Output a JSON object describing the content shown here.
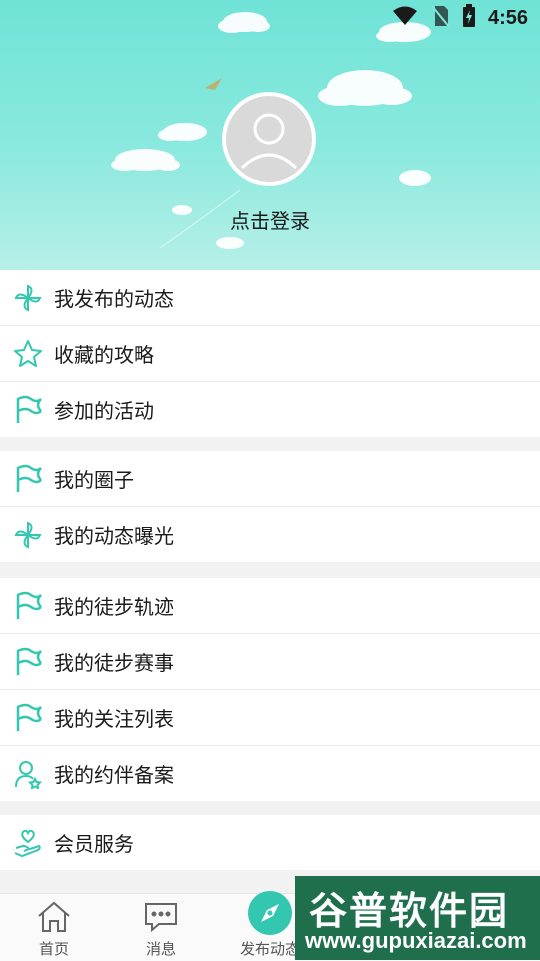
{
  "status": {
    "time": "4:56"
  },
  "profile": {
    "login_text": "点击登录"
  },
  "menu": {
    "group1": [
      {
        "label": "我发布的动态",
        "icon": "pinwheel-icon"
      },
      {
        "label": "收藏的攻略",
        "icon": "star-icon"
      },
      {
        "label": "参加的活动",
        "icon": "flag-icon"
      }
    ],
    "group2": [
      {
        "label": "我的圈子",
        "icon": "flag-icon"
      },
      {
        "label": "我的动态曝光",
        "icon": "pinwheel-icon"
      }
    ],
    "group3": [
      {
        "label": "我的徒步轨迹",
        "icon": "flag-icon"
      },
      {
        "label": "我的徒步赛事",
        "icon": "flag-icon"
      },
      {
        "label": "我的关注列表",
        "icon": "flag-icon"
      },
      {
        "label": "我的约伴备案",
        "icon": "user-icon"
      }
    ],
    "group4": [
      {
        "label": "会员服务",
        "icon": "heart-hand-icon"
      }
    ]
  },
  "nav": {
    "tabs": [
      {
        "label": "首页",
        "icon": "home-icon"
      },
      {
        "label": "消息",
        "icon": "message-icon"
      },
      {
        "label": "发布动态",
        "icon": "compass-icon"
      }
    ]
  },
  "watermark": {
    "title": "谷普软件园",
    "url": "www.gupuxiazai.com"
  },
  "colors": {
    "accent": "#33c7b0",
    "header": "#7ee6da"
  }
}
